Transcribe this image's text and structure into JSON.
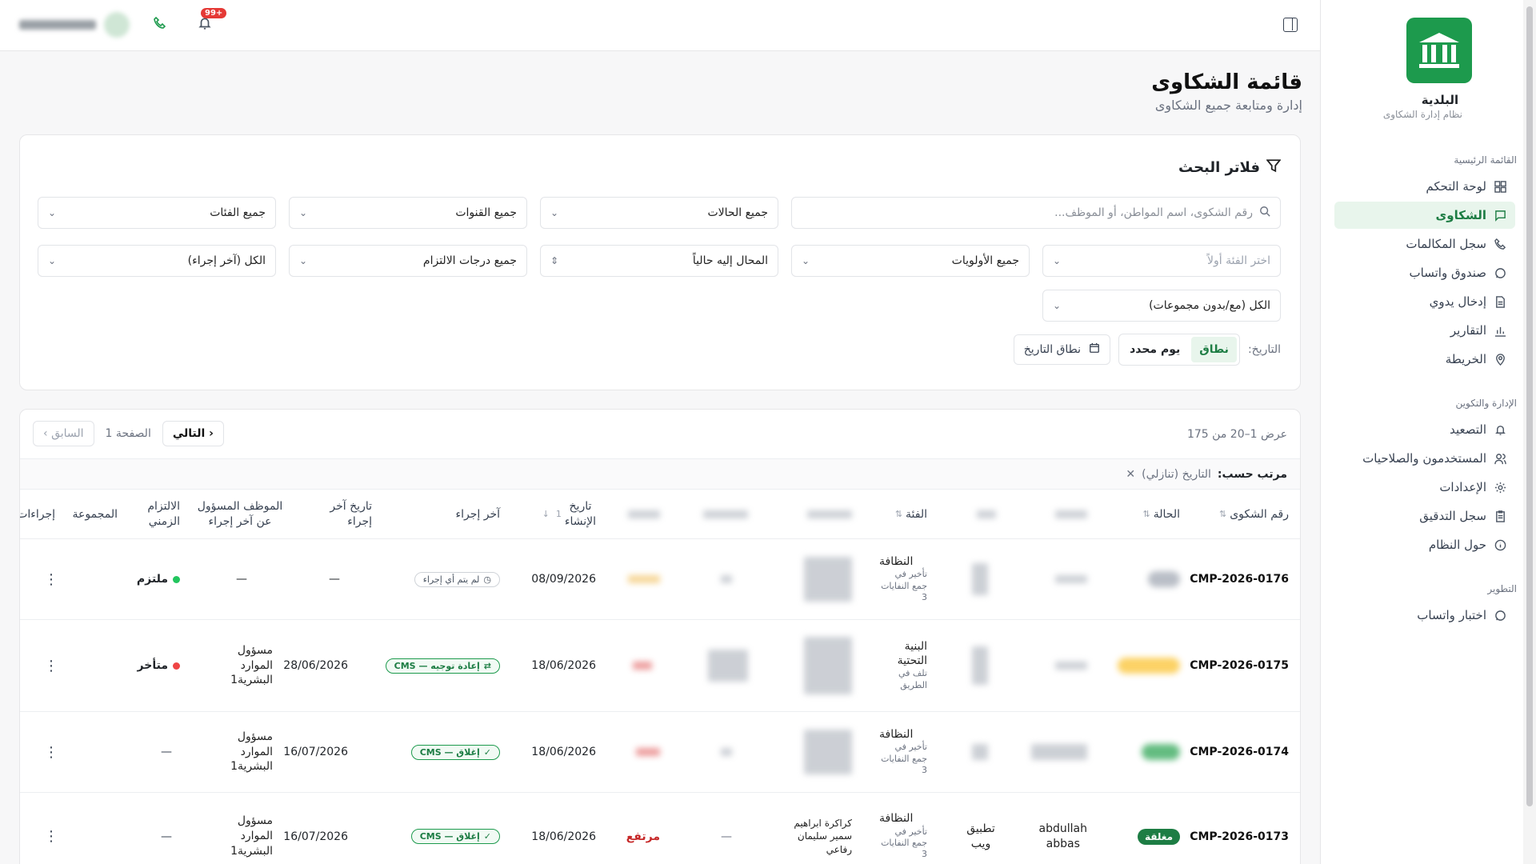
{
  "sidebar": {
    "brand_name": "البلدية",
    "brand_sub": "نظام إدارة الشكاوى",
    "section_main": "القائمة الرئيسية",
    "section_admin": "الإدارة والتكوين",
    "section_dev": "التطوير",
    "items": [
      {
        "label": "لوحة التحكم",
        "icon": "dashboard-icon"
      },
      {
        "label": "الشكاوى",
        "icon": "message-icon",
        "active": true
      },
      {
        "label": "سجل المكالمات",
        "icon": "phone-icon"
      },
      {
        "label": "صندوق واتساب",
        "icon": "chat-icon"
      },
      {
        "label": "إدخال يدوي",
        "icon": "file-icon"
      },
      {
        "label": "التقارير",
        "icon": "bar-chart-icon"
      },
      {
        "label": "الخريطة",
        "icon": "map-pin-icon"
      }
    ],
    "admin_items": [
      {
        "label": "التصعيد",
        "icon": "bell-icon"
      },
      {
        "label": "المستخدمون والصلاحيات",
        "icon": "users-icon"
      },
      {
        "label": "الإعدادات",
        "icon": "gear-icon"
      },
      {
        "label": "سجل التدقيق",
        "icon": "clipboard-icon"
      },
      {
        "label": "حول النظام",
        "icon": "info-icon"
      }
    ],
    "dev_items": [
      {
        "label": "اختبار واتساب",
        "icon": "chat-icon"
      }
    ]
  },
  "topbar": {
    "notif_badge": "+99"
  },
  "header": {
    "title": "قائمة الشكاوى",
    "subtitle": "إدارة ومتابعة جميع الشكاوى"
  },
  "filters": {
    "title": "فلاتر البحث",
    "search_placeholder": "رقم الشكوى، اسم المواطن، أو الموظف...",
    "status": "جميع الحالات",
    "channels": "جميع القنوات",
    "categories": "جميع الفئات",
    "subcategory": "اختر الفئة أولاً",
    "priorities": "جميع الأولويات",
    "assigned": "المحال إليه حالياً",
    "compliance": "جميع درجات الالتزام",
    "last_action": "الكل (آخر إجراء)",
    "groups": "الكل (مع/بدون مجموعات)",
    "date_label": "التاريخ:",
    "date_range_tab": "نطاق",
    "date_day_tab": "يوم محدد",
    "date_range_btn": "نطاق التاريخ"
  },
  "table": {
    "shown": "عرض 1–20 من 175",
    "prev": "السابق",
    "page": "الصفحة 1",
    "next": "التالي",
    "sort_label": "مرتب حسب:",
    "sort_value": "التاريخ (تنازلي)",
    "headers": {
      "id": "رقم الشكوى",
      "status": "الحالة",
      "category": "الفئة",
      "created": "تاريخ الإنشاء",
      "last_action": "آخر إجراء",
      "last_action_date": "تاريخ آخر إجراء",
      "responsible": "الموظف المسؤول عن آخر إجراء",
      "sla": "الالتزام الزمني",
      "group": "المجموعة",
      "actions": "إجراءات"
    },
    "sort_index": "1",
    "rows": [
      {
        "id": "CMP-2026-0176",
        "status_color": "#9ca3af",
        "category": "النظافة",
        "subcategory": "تأخير في جمع النفايات 3",
        "created": "08/09/2026",
        "last_action": "لم يتم أي إجراء",
        "last_action_type": "gray",
        "last_action_date": "—",
        "responsible": "—",
        "sla": "ملتزم",
        "sla_color": "#22c55e",
        "group": ""
      },
      {
        "id": "CMP-2026-0175",
        "status_color": "#fbbf24",
        "category": "البنية التحتية",
        "subcategory": "تلف في الطريق",
        "created": "18/06/2026",
        "last_action": "إعادة توجيه — CMS",
        "last_action_type": "green",
        "last_action_date": "28/06/2026",
        "responsible": "مسؤول الموارد البشرية1",
        "sla": "متأخر",
        "sla_color": "#ef4444",
        "group": ""
      },
      {
        "id": "CMP-2026-0174",
        "status_color": "#22a04b",
        "category": "النظافة",
        "subcategory": "تأخير في جمع النفايات 3",
        "created": "18/06/2026",
        "last_action": "إغلاق — CMS",
        "last_action_type": "green",
        "last_action_date": "16/07/2026",
        "responsible": "مسؤول الموارد البشرية1",
        "sla": "—",
        "sla_color": "",
        "group": ""
      },
      {
        "id": "CMP-2026-0173",
        "status": "مغلقة",
        "status_color": "#1d7d44",
        "citizen": "abdullah abbas",
        "channel": "تطبيق ويب",
        "category": "النظافة",
        "subcategory": "تأخير في جمع النفايات 3",
        "assignees": "كراكرة ابراهيم سمير سليمان رفاعي",
        "dash": "—",
        "priority": "مرتفع",
        "created": "18/06/2026",
        "last_action": "إغلاق — CMS",
        "last_action_type": "green",
        "last_action_date": "16/07/2026",
        "responsible": "مسؤول الموارد البشرية1",
        "sla": "—",
        "sla_color": "",
        "group": ""
      }
    ]
  },
  "colors": {
    "brand": "#1d9a4d",
    "active_bg": "#e8f5ec",
    "danger": "#ef4444",
    "success": "#22c55e"
  }
}
